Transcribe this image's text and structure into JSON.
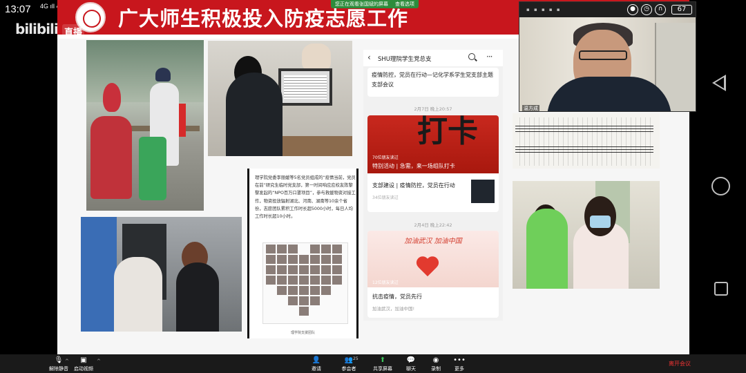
{
  "status": {
    "time": "13:07",
    "signal": "4G ıll 4G"
  },
  "overlay": {
    "logo": "bilibili",
    "live": "直播"
  },
  "screen_share": {
    "bar_left": "您正在观看张国斌的屏幕",
    "bar_right": "查看选项"
  },
  "slide": {
    "title": "广大师生积极投入防疫志愿工作",
    "text_card": "理学院党委李丽媛等5名党员组成的“疫情当前，党员在前”研究生临时党支部，第一时间响应应校友陈黎黎发起的“NPO百万口罩项目”，参与救援物资对接工作，物资投放辐射湖北、河南、湖南等10余个省份，志愿团队累积工作时长超5000小时，每日人均工作时长超10小时。",
    "text_card_caption": "理学院支援团队"
  },
  "phone": {
    "title": "SHU理院学生党总支",
    "article1": "疫情防控，党员在行动—记化学系学生党支部主题支部会议",
    "time1": "2月7日 晚上20:57",
    "cardA_glyph": "打卡",
    "cardA_views": "70位朋友读过",
    "cardA_caption": "特别活动 | 急需，来一场组队打卡",
    "cardA_sub": "支部建设 | 疫情防控，党员在行动",
    "cardA_sub_views": "34位朋友读过",
    "time2": "2月4日 晚上22:42",
    "cardB_slogan": "加油武汉 加油中国",
    "cardB_views": "12位朋友读过",
    "cardB_title": "抗击疫情，党员先行",
    "cardB_sub": "加油武汉，加油中国!"
  },
  "webcam": {
    "name": "温方成",
    "battery": "67"
  },
  "toolbar": {
    "mute": "解除静音",
    "video": "启动视频",
    "invite": "邀请",
    "participants": "参会者",
    "participants_count": "25",
    "share": "共享屏幕",
    "chat": "聊天",
    "record": "录制",
    "more": "更多",
    "leave": "离开会议"
  }
}
